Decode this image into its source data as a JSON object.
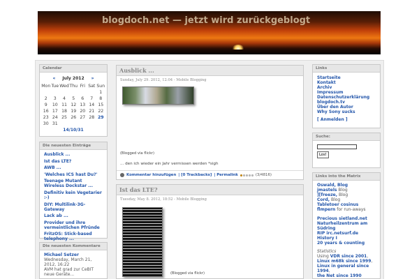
{
  "header": {
    "site_title": "blogdoch.net — jetzt wird zurückgeblogt"
  },
  "calendar": {
    "title": "Calendar",
    "prev": "«",
    "next": "»",
    "month": "July 2012",
    "weekdays": [
      "Mon",
      "Tue",
      "Wed",
      "Thu",
      "Fri",
      "Sat",
      "Sun"
    ],
    "weeks": [
      [
        "",
        "",
        "",
        "",
        "",
        "",
        "1"
      ],
      [
        "2",
        "3",
        "4",
        "5",
        "6",
        "7",
        "8"
      ],
      [
        "9",
        "10",
        "11",
        "12",
        "13",
        "14",
        "15"
      ],
      [
        "16",
        "17",
        "18",
        "19",
        "20",
        "21",
        "22"
      ],
      [
        "23",
        "24",
        "25",
        "26",
        "27",
        "28",
        "29"
      ],
      [
        "30",
        "31",
        "",
        "",
        "",
        "",
        ""
      ]
    ],
    "linked_days": [
      "29"
    ],
    "footer": "14/10/31"
  },
  "entries": {
    "title": "Die neuesten Einträge",
    "items": [
      "Ausblick ...",
      "Ist das LTE?",
      "AWB ...",
      "'Welches ICS hast Du?'",
      "Teenage Mutant Wireless Dockstar ...",
      "Definitiv kein Vegetarier :-)",
      "DIY: Multilink-3G-Gateway",
      "Lack ab ...",
      "Provider und ihre vermeintlichen Pfründe",
      "FritzOS: Stick-based telephony ..."
    ]
  },
  "comments": {
    "title": "Die neuesten Kommentare",
    "author": "Michael Setzer",
    "date": "Wednesday, March 21, 2012, 16:22",
    "text": "AVM hat grad zur CeBIT neue Geräte..."
  },
  "post1": {
    "title": "Ausblick ...",
    "meta": "Sunday, July 29. 2012, 12:04 - Mobile Blogging",
    "caption": "(Blogged via flickr)",
    "body": "... den ich wieder ein Jahr vermissen werden *sigh",
    "comment_link": "Kommentar hinzufügen",
    "trackbacks": "| [0 Trackbacks]",
    "permalink": "| Permalink",
    "rating": "(3/4816)",
    "stars_on": 1
  },
  "post2": {
    "title": "Ist das LTE?",
    "meta": "Tuesday, May 8. 2012, 18:52 - Mobile Blogging",
    "caption": "(Blogged via flickr)"
  },
  "links": {
    "title": "Links",
    "items": [
      "Startseite",
      "Kontakt",
      "Archiv",
      "Impressum",
      "Datenschutzerklärung",
      "blogdoch.tv",
      "Über den Autor",
      "Why Sony sucks"
    ],
    "login": "[ Anmelden ]"
  },
  "search": {
    "title": "Suche:",
    "value": "",
    "button": "Los!"
  },
  "matrix": {
    "title": "Links into the Matrix",
    "items": [
      {
        "link": "Oswald, Blog",
        "rest": ""
      },
      {
        "link": "jmastels",
        "rest": " Blog"
      },
      {
        "link": "][freeze,",
        "rest": " Blog"
      },
      {
        "link": "Cord,",
        "rest": " Blog"
      },
      {
        "link": "Tabletoer cosinus",
        "rest": ""
      },
      {
        "link": "flmpern",
        "rest": " for run-aways"
      }
    ],
    "items2": [
      "Precious sietland.net",
      "Naturheilzentrum am Südring",
      "RIP irc.netsurf.de",
      "History I",
      "20 years & counting"
    ],
    "stats_title": "Statistics",
    "stats": [
      {
        "pre": "Using ",
        "link": "VDR since 2001",
        "post": ","
      },
      {
        "pre": "",
        "link": "Linux m68k since 1999",
        "post": ","
      },
      {
        "pre": "",
        "link": "Linux in general since 1994",
        "post": ","
      },
      {
        "pre": "",
        "link": "the Net since 1990",
        "post": ""
      }
    ]
  }
}
